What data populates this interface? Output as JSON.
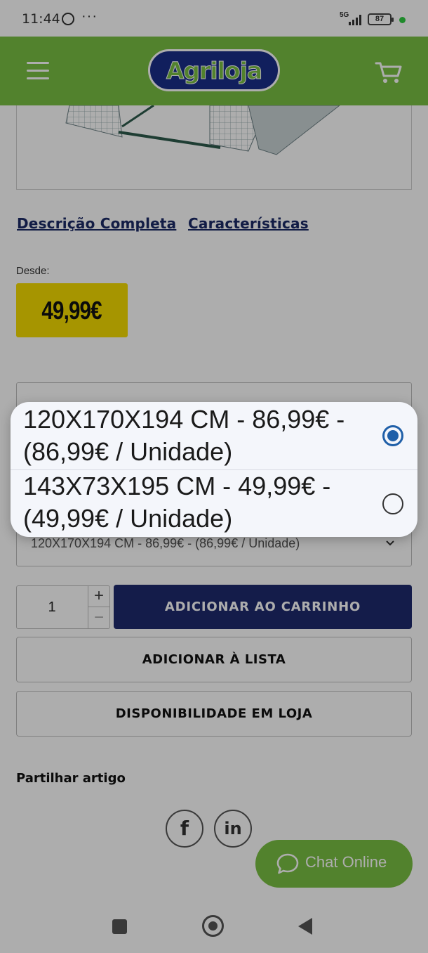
{
  "status_bar": {
    "time": "11:44",
    "network": "5G",
    "battery": "87"
  },
  "header": {
    "logo_text": "Agriloja",
    "menu_icon": "hamburger-icon",
    "cart_icon": "cart-icon",
    "color": "#7ac043"
  },
  "tabs": [
    {
      "label": "Descrição Completa"
    },
    {
      "label": "Características"
    }
  ],
  "price": {
    "prefix": "Desde:",
    "value": "49,99€",
    "badge_color": "#f5dc00"
  },
  "variant_select": {
    "selected": "120X170X194 CM - 86,99€ - (86,99€ / Unidade)"
  },
  "quantity": {
    "value": "1",
    "plus": "+",
    "minus": "−"
  },
  "buttons": {
    "add_to_cart": "ADICIONAR AO CARRINHO",
    "add_to_list": "ADICIONAR À LISTA",
    "store_availability": "DISPONIBILIDADE EM LOJA",
    "add_to_cart_color": "#1e2a6e"
  },
  "share": {
    "title": "Partilhar artigo",
    "facebook": "f",
    "linkedin": "in"
  },
  "chat": {
    "label": "Chat Online",
    "icon": "chat-bubble-icon"
  },
  "picker": {
    "options": [
      {
        "label": "120X170X194 CM - 86,99€ - (86,99€ / Unidade)",
        "selected": true
      },
      {
        "label": "143X73X195 CM - 49,99€ - (49,99€ / Unidade)",
        "selected": false
      }
    ],
    "accent_color": "#1f5fa8"
  }
}
